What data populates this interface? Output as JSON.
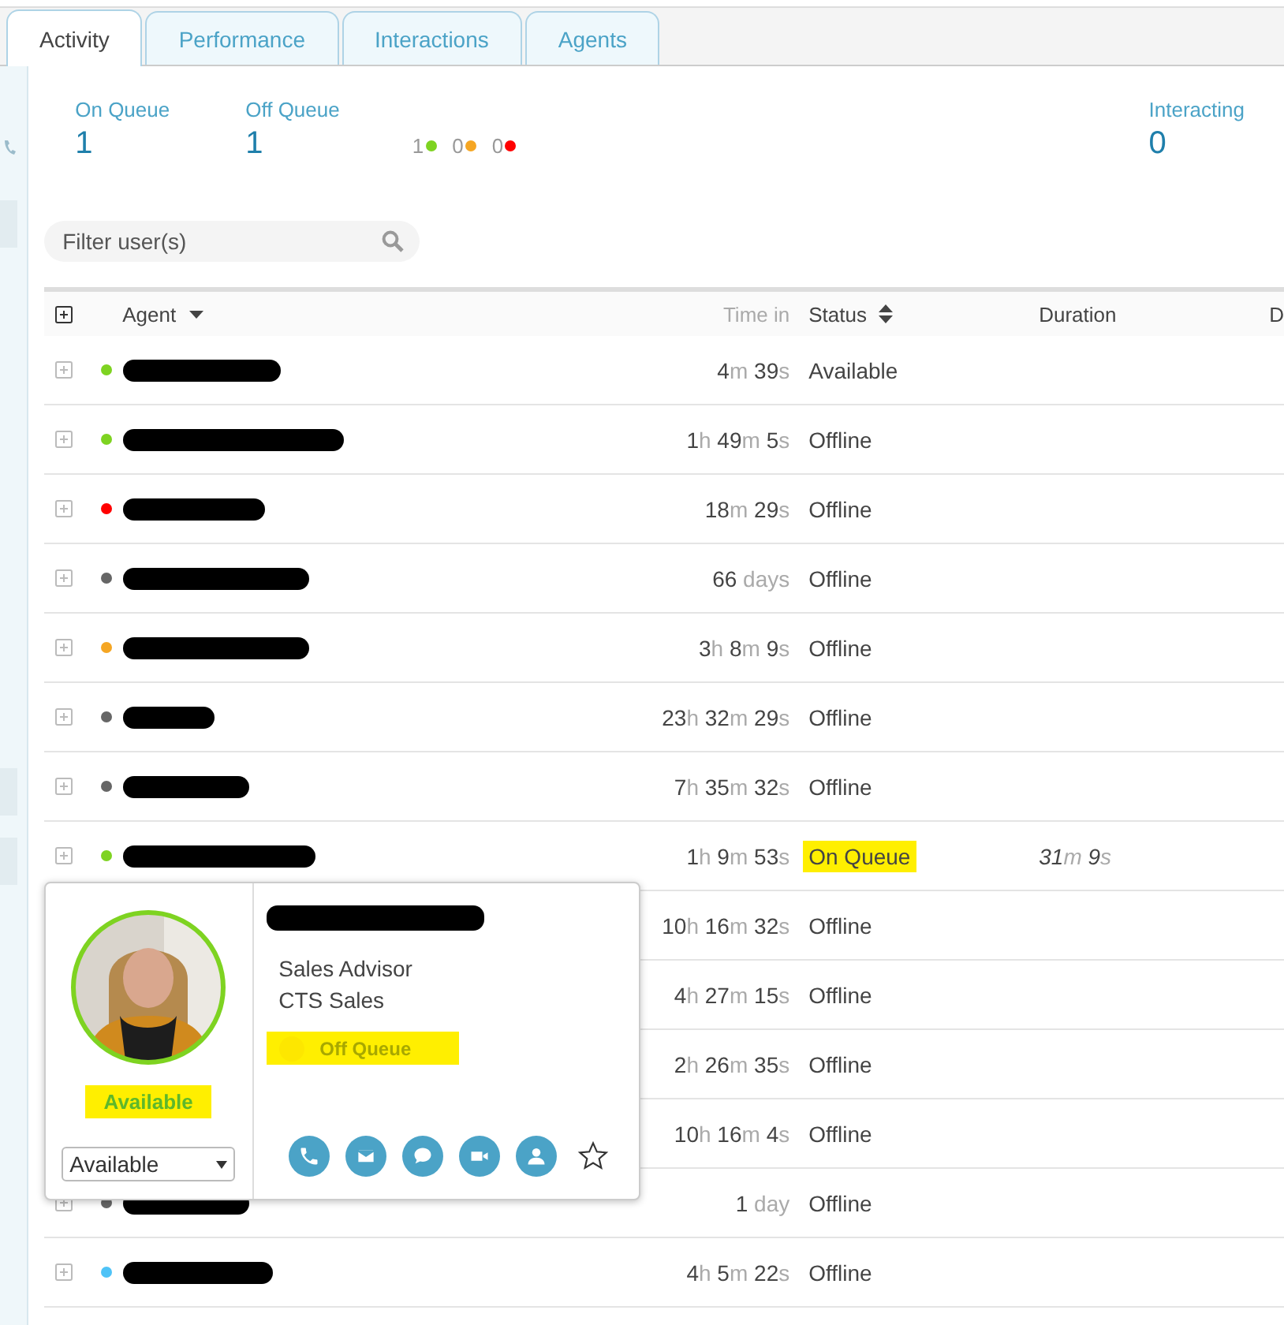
{
  "tabs": [
    {
      "label": "Activity",
      "selected": true
    },
    {
      "label": "Performance",
      "selected": false
    },
    {
      "label": "Interactions",
      "selected": false
    },
    {
      "label": "Agents",
      "selected": false
    }
  ],
  "stats": [
    {
      "label": "On Queue",
      "value": "1"
    },
    {
      "label": "Off Queue",
      "value": "1"
    }
  ],
  "dot_counts": [
    {
      "count": "1",
      "color": "#7ed321"
    },
    {
      "count": "0",
      "color": "#f5a623"
    },
    {
      "count": "0",
      "color": "#ff0000"
    }
  ],
  "interacting": {
    "label": "Interacting",
    "value": "0"
  },
  "filter": {
    "placeholder": "Filter user(s)"
  },
  "table": {
    "columns": [
      {
        "label": "Agent",
        "sortable": true,
        "sorted": true
      },
      {
        "label": "Time in",
        "sortable": false,
        "sorted": false
      },
      {
        "label": "Status",
        "sortable": true,
        "sorted": false
      },
      {
        "label": "Duration",
        "sortable": false,
        "sorted": false
      },
      {
        "label": "D",
        "sortable": false,
        "sorted": false
      }
    ],
    "rows": [
      {
        "color": "#7ed321",
        "redacted": true,
        "time_in": "4m 39s",
        "status": "Available",
        "highlighted": false
      },
      {
        "color": "#7ed321",
        "redacted": true,
        "time_in": "1h 49m 5s",
        "status": "Offline",
        "highlighted": false
      },
      {
        "color": "#ff0000",
        "redacted": true,
        "time_in": "18m 29s",
        "status": "Offline",
        "highlighted": false
      },
      {
        "color": "#666666",
        "redacted": true,
        "time_in": "66 days",
        "status": "Offline",
        "highlighted": false
      },
      {
        "color": "#f5a623",
        "redacted": true,
        "time_in": "3h 8m 9s",
        "status": "Offline",
        "highlighted": false
      },
      {
        "color": "#666666",
        "redacted": true,
        "time_in": "23h 32m 29s",
        "status": "Offline",
        "highlighted": false
      },
      {
        "color": "#666666",
        "redacted": true,
        "time_in": "7h 35m 32s",
        "status": "Offline",
        "highlighted": false
      },
      {
        "color": "#7ed321",
        "redacted": true,
        "time_in": "1h 9m 53s",
        "status": "On Queue",
        "highlighted": true,
        "duration": "31m 9s"
      },
      {
        "redacted": false,
        "time_in": "10h 16m 32s",
        "status": "Offline",
        "highlighted": false
      },
      {
        "redacted": false,
        "time_in": "4h 27m 15s",
        "status": "Offline",
        "highlighted": false
      },
      {
        "redacted": false,
        "time_in": "2h 26m 35s",
        "status": "Offline",
        "highlighted": false
      },
      {
        "redacted": false,
        "time_in": "10h 16m 4s",
        "status": "Offline",
        "highlighted": false
      },
      {
        "color": "#666666",
        "redacted": true,
        "time_in": "1 day",
        "status": "Offline",
        "highlighted": false
      },
      {
        "color": "#4fc3f7",
        "redacted": true,
        "time_in": "4h 5m 22s",
        "status": "Offline",
        "highlighted": false
      }
    ]
  },
  "profile_card": {
    "redacted_name": true,
    "title": "Sales Advisor",
    "department": "CTS Sales",
    "presence": {
      "label": "Available",
      "highlighted": true
    },
    "presence_select": {
      "value": "Available"
    },
    "queue_toggle": {
      "label": "Off Queue",
      "on": false,
      "highlighted": true
    },
    "actions": [
      {
        "kind": "phone"
      },
      {
        "kind": "email"
      },
      {
        "kind": "chat"
      },
      {
        "kind": "video"
      },
      {
        "kind": "profile"
      },
      {
        "kind": "favorite"
      }
    ]
  }
}
